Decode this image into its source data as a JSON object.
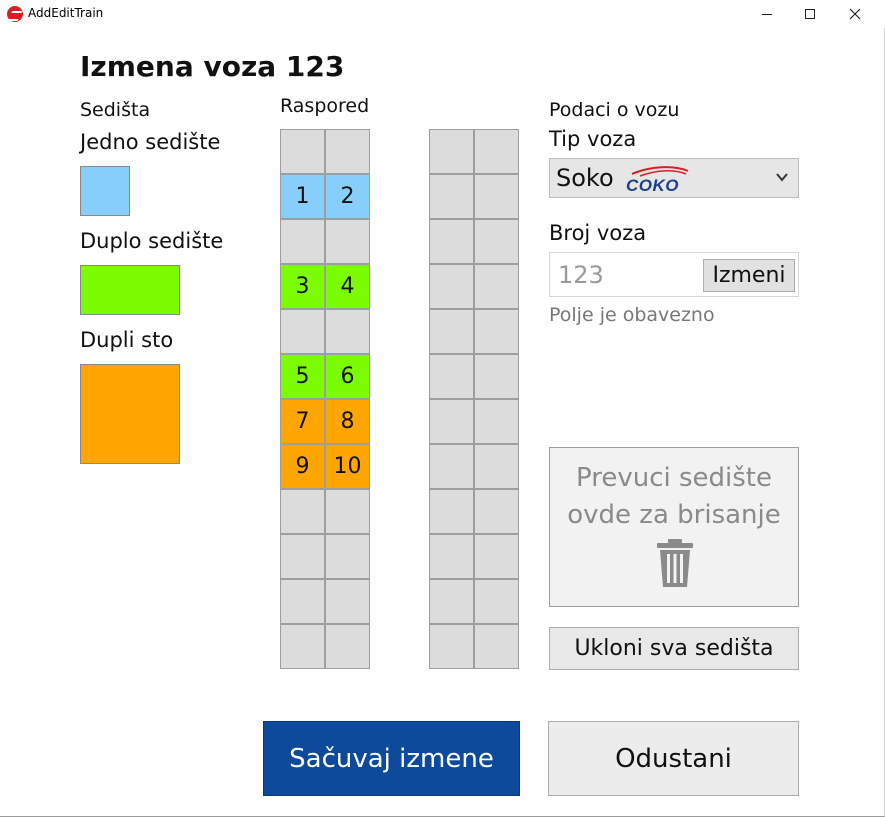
{
  "window": {
    "title": "AddEditTrain"
  },
  "heading": "Izmena voza 123",
  "seats_panel": {
    "label": "Sedišta",
    "single_label": "Jedno sedište",
    "double_label": "Duplo sedište",
    "table_label": "Dupli sto",
    "colors": {
      "single": "#87cefa",
      "double": "#7cfc00",
      "table": "#ffa500",
      "empty": "#dcdcdc"
    }
  },
  "layout_panel": {
    "label": "Raspored",
    "columns": [
      {
        "rows": [
          [
            "",
            ""
          ],
          [
            "1",
            "2"
          ],
          [
            "",
            ""
          ],
          [
            "3",
            "4"
          ],
          [
            "",
            ""
          ],
          [
            "5",
            "6"
          ],
          [
            "7",
            "8"
          ],
          [
            "9",
            "10"
          ],
          [
            "",
            ""
          ],
          [
            "",
            ""
          ],
          [
            "",
            ""
          ],
          [
            "",
            ""
          ]
        ],
        "row_types": [
          "empty",
          "single",
          "empty",
          "double",
          "empty",
          "double",
          "table",
          "table",
          "empty",
          "empty",
          "empty",
          "empty"
        ]
      },
      {
        "rows": [
          [
            "",
            ""
          ],
          [
            "",
            ""
          ],
          [
            "",
            ""
          ],
          [
            "",
            ""
          ],
          [
            "",
            ""
          ],
          [
            "",
            ""
          ],
          [
            "",
            ""
          ],
          [
            "",
            ""
          ],
          [
            "",
            ""
          ],
          [
            "",
            ""
          ],
          [
            "",
            ""
          ],
          [
            "",
            ""
          ]
        ],
        "row_types": [
          "empty",
          "empty",
          "empty",
          "empty",
          "empty",
          "empty",
          "empty",
          "empty",
          "empty",
          "empty",
          "empty",
          "empty"
        ]
      }
    ]
  },
  "train_info": {
    "label": "Podaci o vozu",
    "type_label": "Tip voza",
    "type_value": "Soko",
    "type_logo_text": "COKO",
    "number_label": "Broj voza",
    "number_value": "123",
    "change_button": "Izmeni",
    "required_hint": "Polje je obavezno"
  },
  "trash_zone": {
    "line1": "Prevuci sedište",
    "line2": "ovde za brisanje"
  },
  "buttons": {
    "remove_all": "Ukloni sva sedišta",
    "save": "Sačuvaj izmene",
    "cancel": "Odustani"
  }
}
